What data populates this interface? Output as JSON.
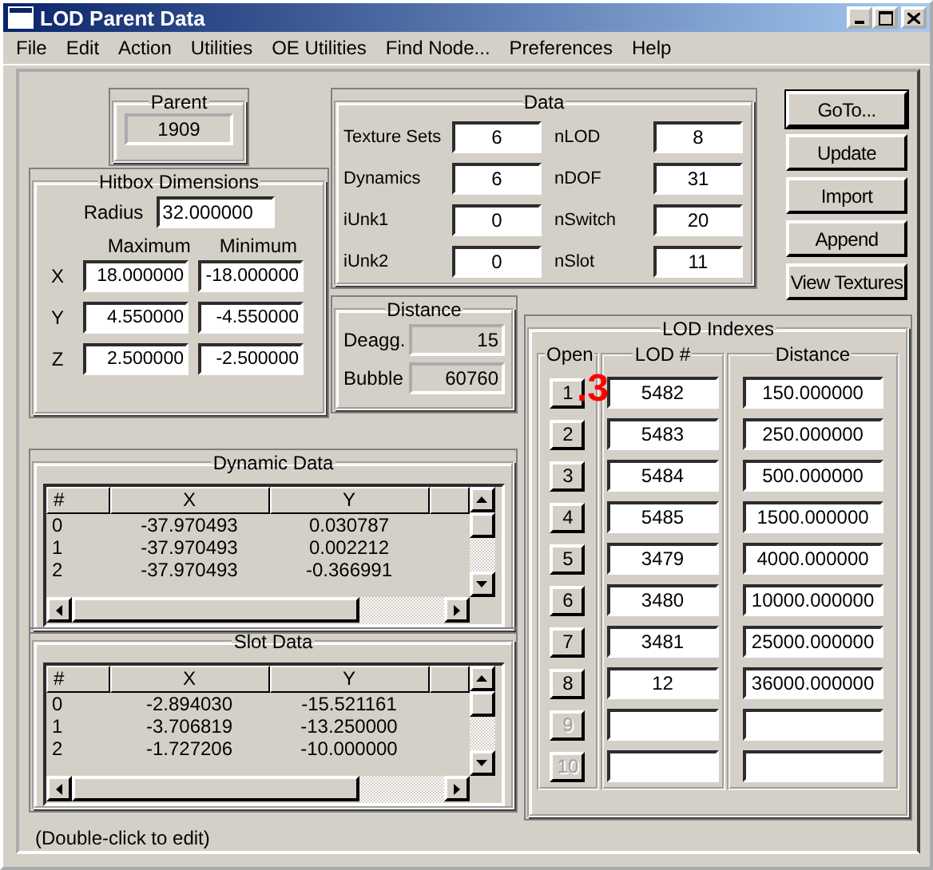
{
  "window": {
    "title": "LOD Parent Data"
  },
  "menu": [
    "File",
    "Edit",
    "Action",
    "Utilities",
    "OE Utilities",
    "Find Node...",
    "Preferences",
    "Help"
  ],
  "parent": {
    "title": "Parent",
    "value": "1909"
  },
  "hitbox": {
    "title": "Hitbox Dimensions",
    "radius_label": "Radius",
    "radius": "32.000000",
    "max_title": "Maximum",
    "min_title": "Minimum",
    "rows": [
      {
        "axis": "X",
        "max": "18.000000",
        "min": "-18.000000"
      },
      {
        "axis": "Y",
        "max": "4.550000",
        "min": "-4.550000"
      },
      {
        "axis": "Z",
        "max": "2.500000",
        "min": "-2.500000"
      }
    ]
  },
  "data": {
    "title": "Data",
    "fields": [
      {
        "label": "Texture Sets",
        "value": "6"
      },
      {
        "label": "Dynamics",
        "value": "6"
      },
      {
        "label": "iUnk1",
        "value": "0"
      },
      {
        "label": "iUnk2",
        "value": "0"
      },
      {
        "label": "nLOD",
        "value": "8"
      },
      {
        "label": "nDOF",
        "value": "31"
      },
      {
        "label": "nSwitch",
        "value": "20"
      },
      {
        "label": "nSlot",
        "value": "11"
      }
    ]
  },
  "buttons": [
    {
      "label": "GoTo...",
      "default": true
    },
    {
      "label": "Update",
      "default": false
    },
    {
      "label": "Import",
      "default": false
    },
    {
      "label": "Append",
      "default": false
    },
    {
      "label": "View Textures",
      "default": false
    }
  ],
  "distance": {
    "title": "Distance",
    "fields": [
      {
        "label": "Deagg.",
        "value": "15"
      },
      {
        "label": "Bubble",
        "value": "60760"
      }
    ]
  },
  "lod_indexes": {
    "title": "LOD Indexes",
    "open_title": "Open",
    "lod_title": "LOD #",
    "distance_title": "Distance",
    "annotation": ".3",
    "rows": [
      {
        "button": "1",
        "disabled": false,
        "lod": "5482",
        "distance": "150.000000"
      },
      {
        "button": "2",
        "disabled": false,
        "lod": "5483",
        "distance": "250.000000"
      },
      {
        "button": "3",
        "disabled": false,
        "lod": "5484",
        "distance": "500.000000"
      },
      {
        "button": "4",
        "disabled": false,
        "lod": "5485",
        "distance": "1500.000000"
      },
      {
        "button": "5",
        "disabled": false,
        "lod": "3479",
        "distance": "4000.000000"
      },
      {
        "button": "6",
        "disabled": false,
        "lod": "3480",
        "distance": "10000.000000"
      },
      {
        "button": "7",
        "disabled": false,
        "lod": "3481",
        "distance": "25000.000000"
      },
      {
        "button": "8",
        "disabled": false,
        "lod": "12",
        "distance": "36000.000000"
      },
      {
        "button": "9",
        "disabled": true
      },
      {
        "button": "10",
        "disabled": true
      }
    ]
  },
  "dynamic_data": {
    "title": "Dynamic Data",
    "columns": [
      "#",
      "X",
      "Y"
    ],
    "rows": [
      [
        "0",
        "-37.970493",
        "0.030787"
      ],
      [
        "1",
        "-37.970493",
        "0.002212"
      ],
      [
        "2",
        "-37.970493",
        "-0.366991"
      ]
    ]
  },
  "slot_data": {
    "title": "Slot Data",
    "columns": [
      "#",
      "X",
      "Y"
    ],
    "rows": [
      [
        "0",
        "-2.894030",
        "-15.521161"
      ],
      [
        "1",
        "-3.706819",
        "-13.250000"
      ],
      [
        "2",
        "-1.727206",
        "-10.000000"
      ]
    ]
  },
  "hint": "(Double-click to edit)"
}
